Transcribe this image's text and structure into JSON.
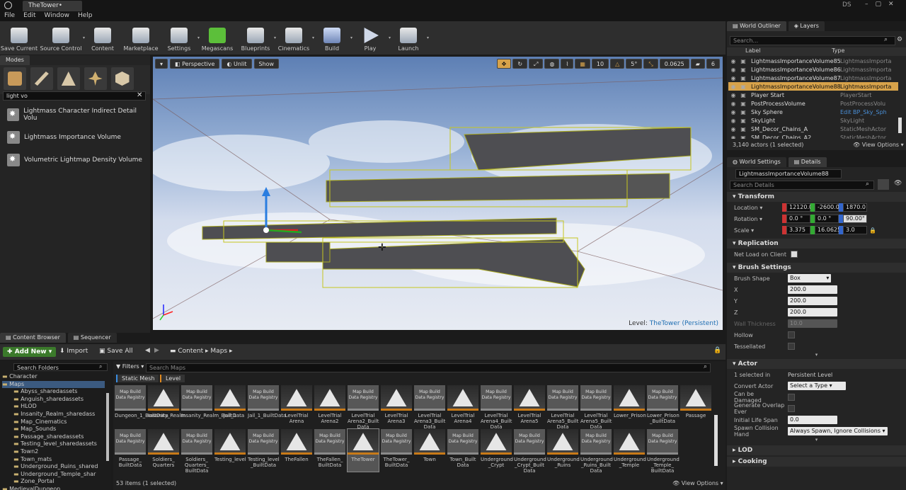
{
  "window": {
    "tab_title": "TheTower•",
    "user_badge": "DS"
  },
  "menu": [
    "File",
    "Edit",
    "Window",
    "Help"
  ],
  "toolbar": [
    "Save Current",
    "Source Control",
    "Content",
    "Marketplace",
    "Settings",
    "Megascans",
    "Blueprints",
    "Cinematics",
    "Build",
    "Play",
    "Launch"
  ],
  "modes": {
    "tab": "Modes",
    "search_value": "light vo",
    "results": [
      "Lightmass Character Indirect Detail Volu",
      "Lightmass Importance Volume",
      "Volumetric Lightmap Density Volume"
    ]
  },
  "viewport": {
    "perspective": "Perspective",
    "unlit": "Unlit",
    "show": "Show",
    "grid_snap": "10",
    "rot_snap": "5°",
    "scale_snap": "0.0625",
    "camera_speed": "6",
    "level_label": "Level:",
    "level_name": "TheTower (Persistent)"
  },
  "outliner": {
    "tab": "World Outliner",
    "layers_tab": "Layers",
    "search_placeholder": "Search...",
    "col_label": "Label",
    "col_type": "Type",
    "rows": [
      {
        "label": "LightmassImportanceVolume85",
        "type": "LightmassImporta",
        "selected": false
      },
      {
        "label": "LightmassImportanceVolume86",
        "type": "LightmassImporta",
        "selected": false
      },
      {
        "label": "LightmassImportanceVolume87",
        "type": "LightmassImporta",
        "selected": false
      },
      {
        "label": "LightmassImportanceVolume88",
        "type": "LightmassImporta",
        "selected": true
      },
      {
        "label": "Player Start",
        "type": "PlayerStart",
        "selected": false
      },
      {
        "label": "PostProcessVolume",
        "type": "PostProcessVolu",
        "selected": false
      },
      {
        "label": "Sky Sphere",
        "type": "Edit BP_Sky_Sph",
        "selected": false
      },
      {
        "label": "SkyLight",
        "type": "SkyLight",
        "selected": false
      },
      {
        "label": "SM_Decor_Chains_A",
        "type": "StaticMeshActor",
        "selected": false
      },
      {
        "label": "SM_Decor_Chains_A2",
        "type": "StaticMeshActor",
        "selected": false
      }
    ],
    "status": "3,140 actors (1 selected)",
    "view_options": "View Options"
  },
  "details": {
    "world_settings_tab": "World Settings",
    "details_tab": "Details",
    "actor_name": "LightmassImportanceVolume88",
    "search_placeholder": "Search Details",
    "transform": {
      "title": "Transform",
      "location_label": "Location",
      "location": [
        "12120.0",
        "-2600.0",
        "1870.0"
      ],
      "rotation_label": "Rotation",
      "rotation": [
        "0.0 °",
        "0.0 °",
        "90.00°"
      ],
      "scale_label": "Scale",
      "scale": [
        "3.375",
        "16.0625",
        "3.0"
      ]
    },
    "replication": {
      "title": "Replication",
      "net_load": "Net Load on Client"
    },
    "brush": {
      "title": "Brush Settings",
      "shape_label": "Brush Shape",
      "shape": "Box",
      "x_label": "X",
      "x": "200.0",
      "y_label": "Y",
      "y": "200.0",
      "z_label": "Z",
      "z": "200.0",
      "wall_label": "Wall Thickness",
      "wall": "10.0",
      "hollow": "Hollow",
      "tessellated": "Tessellated"
    },
    "actor": {
      "title": "Actor",
      "selected_label": "1 selected in",
      "selected_value": "Persistent Level",
      "convert_label": "Convert Actor",
      "convert_value": "Select a Type",
      "damaged": "Can be Damaged",
      "overlap": "Generate Overlap Ever",
      "lifespan_label": "Initial Life Span",
      "lifespan": "0.0",
      "spawn_label": "Spawn Collision Hand",
      "spawn_value": "Always Spawn, Ignore Collisions"
    },
    "lod": "LOD",
    "cooking": "Cooking"
  },
  "content_browser": {
    "tab": "Content Browser",
    "sequencer_tab": "Sequencer",
    "add_new": "Add New",
    "import": "Import",
    "save_all": "Save All",
    "path": [
      "Content",
      "Maps"
    ],
    "search_folders": "Search Folders",
    "filters": "Filters",
    "search_maps": "Search Maps",
    "chips": [
      "Static Mesh",
      "Level"
    ],
    "status": "53 items (1 selected)",
    "view_options": "View Options",
    "folders": [
      "Character",
      "Maps",
      "Abyss_sharedassets",
      "Anguish_sharedassets",
      "HLOD",
      "Insanity_Realm_sharedass",
      "Map_Cinematics",
      "Map_Sounds",
      "Passage_sharedassets",
      "Testing_level_sharedassets",
      "Town2",
      "Town_mats",
      "Underground_Ruins_shared",
      "Underground_Temple_shar",
      "Zone_Portal",
      "MedievalDungeon"
    ],
    "map_thumb_text": "Map Build Data Registry",
    "row1": [
      {
        "k": "map",
        "n": "Dungeon_1_BuiltData"
      },
      {
        "k": "lvl",
        "n": "Insanity_Realm"
      },
      {
        "k": "map",
        "n": "Insanity_Realm_BuiltData"
      },
      {
        "k": "lvl",
        "n": "Jail_1"
      },
      {
        "k": "map",
        "n": "Jail_1_BuiltData"
      },
      {
        "k": "lvl",
        "n": "LevelTrial Arena"
      },
      {
        "k": "lvl",
        "n": "LevelTrial Arena2"
      },
      {
        "k": "map",
        "n": "LevelTrial Arena2_Built Data"
      },
      {
        "k": "lvl",
        "n": "LevelTrial Arena3"
      },
      {
        "k": "map",
        "n": "LevelTrial Arena3_Built Data"
      },
      {
        "k": "lvl",
        "n": "LevelTrial Arena4"
      },
      {
        "k": "map",
        "n": "LevelTrial Arena4_Built Data"
      },
      {
        "k": "lvl",
        "n": "LevelTrial Arena5"
      },
      {
        "k": "map",
        "n": "LevelTrial Arena5_Built Data"
      },
      {
        "k": "map",
        "n": "LevelTrial Arena5_Built Data"
      },
      {
        "k": "lvl",
        "n": "Lower_Prison"
      },
      {
        "k": "map",
        "n": "Lower_Prison _BuiltData"
      },
      {
        "k": "lvl",
        "n": "Passage"
      }
    ],
    "row2": [
      {
        "k": "map",
        "n": "Passage_ BuiltData"
      },
      {
        "k": "lvl",
        "n": "Soldiers_ Quarters"
      },
      {
        "k": "map",
        "n": "Soldiers_ Quarters_ BuiltData"
      },
      {
        "k": "lvl",
        "n": "Testing_level"
      },
      {
        "k": "map",
        "n": "Testing_level _BuiltData"
      },
      {
        "k": "lvl",
        "n": "TheFallen"
      },
      {
        "k": "map",
        "n": "TheFallen_ BuiltData"
      },
      {
        "k": "lvl",
        "n": "TheTower"
      },
      {
        "k": "map",
        "n": "TheTower_ BuiltData"
      },
      {
        "k": "lvl",
        "n": "Town"
      },
      {
        "k": "map",
        "n": "Town_Built Data"
      },
      {
        "k": "lvl",
        "n": "Underground _Crypt"
      },
      {
        "k": "map",
        "n": "Underground _Crypt_Built Data"
      },
      {
        "k": "lvl",
        "n": "Underground _Ruins"
      },
      {
        "k": "map",
        "n": "Underground _Ruins_Built Data"
      },
      {
        "k": "lvl",
        "n": "Underground _Temple"
      },
      {
        "k": "map",
        "n": "Underground _Temple_ BuiltData"
      }
    ]
  }
}
